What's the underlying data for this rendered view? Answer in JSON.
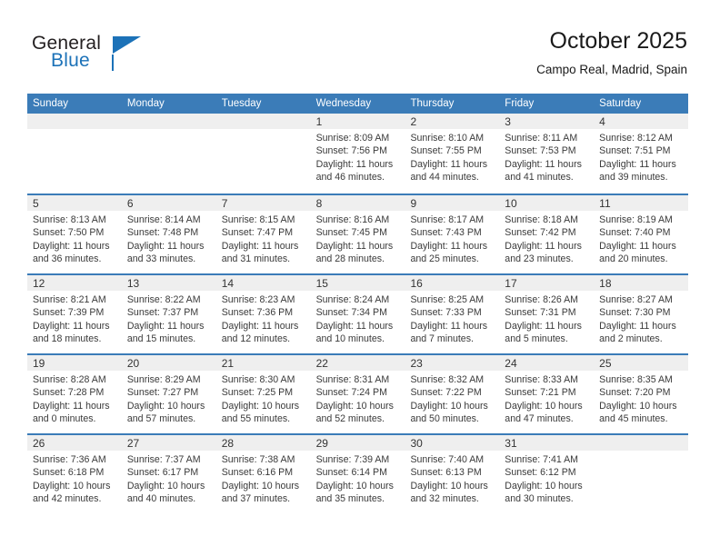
{
  "brand": {
    "name_top": "General",
    "name_bottom": "Blue",
    "accent_color": "#1c72b8",
    "logo_icon": "triangle-flag-icon"
  },
  "header": {
    "title": "October 2025",
    "subtitle": "Campo Real, Madrid, Spain"
  },
  "theme": {
    "header_blue": "#3b7cb8",
    "date_band_gray": "#efefef",
    "text_color": "#3a3a3a"
  },
  "calendar": {
    "weekday_headers": [
      "Sunday",
      "Monday",
      "Tuesday",
      "Wednesday",
      "Thursday",
      "Friday",
      "Saturday"
    ],
    "weeks": [
      [
        {
          "day": "",
          "sunrise": "",
          "sunset": "",
          "daylight1": "",
          "daylight2": ""
        },
        {
          "day": "",
          "sunrise": "",
          "sunset": "",
          "daylight1": "",
          "daylight2": ""
        },
        {
          "day": "",
          "sunrise": "",
          "sunset": "",
          "daylight1": "",
          "daylight2": ""
        },
        {
          "day": "1",
          "sunrise": "Sunrise: 8:09 AM",
          "sunset": "Sunset: 7:56 PM",
          "daylight1": "Daylight: 11 hours",
          "daylight2": "and 46 minutes."
        },
        {
          "day": "2",
          "sunrise": "Sunrise: 8:10 AM",
          "sunset": "Sunset: 7:55 PM",
          "daylight1": "Daylight: 11 hours",
          "daylight2": "and 44 minutes."
        },
        {
          "day": "3",
          "sunrise": "Sunrise: 8:11 AM",
          "sunset": "Sunset: 7:53 PM",
          "daylight1": "Daylight: 11 hours",
          "daylight2": "and 41 minutes."
        },
        {
          "day": "4",
          "sunrise": "Sunrise: 8:12 AM",
          "sunset": "Sunset: 7:51 PM",
          "daylight1": "Daylight: 11 hours",
          "daylight2": "and 39 minutes."
        }
      ],
      [
        {
          "day": "5",
          "sunrise": "Sunrise: 8:13 AM",
          "sunset": "Sunset: 7:50 PM",
          "daylight1": "Daylight: 11 hours",
          "daylight2": "and 36 minutes."
        },
        {
          "day": "6",
          "sunrise": "Sunrise: 8:14 AM",
          "sunset": "Sunset: 7:48 PM",
          "daylight1": "Daylight: 11 hours",
          "daylight2": "and 33 minutes."
        },
        {
          "day": "7",
          "sunrise": "Sunrise: 8:15 AM",
          "sunset": "Sunset: 7:47 PM",
          "daylight1": "Daylight: 11 hours",
          "daylight2": "and 31 minutes."
        },
        {
          "day": "8",
          "sunrise": "Sunrise: 8:16 AM",
          "sunset": "Sunset: 7:45 PM",
          "daylight1": "Daylight: 11 hours",
          "daylight2": "and 28 minutes."
        },
        {
          "day": "9",
          "sunrise": "Sunrise: 8:17 AM",
          "sunset": "Sunset: 7:43 PM",
          "daylight1": "Daylight: 11 hours",
          "daylight2": "and 25 minutes."
        },
        {
          "day": "10",
          "sunrise": "Sunrise: 8:18 AM",
          "sunset": "Sunset: 7:42 PM",
          "daylight1": "Daylight: 11 hours",
          "daylight2": "and 23 minutes."
        },
        {
          "day": "11",
          "sunrise": "Sunrise: 8:19 AM",
          "sunset": "Sunset: 7:40 PM",
          "daylight1": "Daylight: 11 hours",
          "daylight2": "and 20 minutes."
        }
      ],
      [
        {
          "day": "12",
          "sunrise": "Sunrise: 8:21 AM",
          "sunset": "Sunset: 7:39 PM",
          "daylight1": "Daylight: 11 hours",
          "daylight2": "and 18 minutes."
        },
        {
          "day": "13",
          "sunrise": "Sunrise: 8:22 AM",
          "sunset": "Sunset: 7:37 PM",
          "daylight1": "Daylight: 11 hours",
          "daylight2": "and 15 minutes."
        },
        {
          "day": "14",
          "sunrise": "Sunrise: 8:23 AM",
          "sunset": "Sunset: 7:36 PM",
          "daylight1": "Daylight: 11 hours",
          "daylight2": "and 12 minutes."
        },
        {
          "day": "15",
          "sunrise": "Sunrise: 8:24 AM",
          "sunset": "Sunset: 7:34 PM",
          "daylight1": "Daylight: 11 hours",
          "daylight2": "and 10 minutes."
        },
        {
          "day": "16",
          "sunrise": "Sunrise: 8:25 AM",
          "sunset": "Sunset: 7:33 PM",
          "daylight1": "Daylight: 11 hours",
          "daylight2": "and 7 minutes."
        },
        {
          "day": "17",
          "sunrise": "Sunrise: 8:26 AM",
          "sunset": "Sunset: 7:31 PM",
          "daylight1": "Daylight: 11 hours",
          "daylight2": "and 5 minutes."
        },
        {
          "day": "18",
          "sunrise": "Sunrise: 8:27 AM",
          "sunset": "Sunset: 7:30 PM",
          "daylight1": "Daylight: 11 hours",
          "daylight2": "and 2 minutes."
        }
      ],
      [
        {
          "day": "19",
          "sunrise": "Sunrise: 8:28 AM",
          "sunset": "Sunset: 7:28 PM",
          "daylight1": "Daylight: 11 hours",
          "daylight2": "and 0 minutes."
        },
        {
          "day": "20",
          "sunrise": "Sunrise: 8:29 AM",
          "sunset": "Sunset: 7:27 PM",
          "daylight1": "Daylight: 10 hours",
          "daylight2": "and 57 minutes."
        },
        {
          "day": "21",
          "sunrise": "Sunrise: 8:30 AM",
          "sunset": "Sunset: 7:25 PM",
          "daylight1": "Daylight: 10 hours",
          "daylight2": "and 55 minutes."
        },
        {
          "day": "22",
          "sunrise": "Sunrise: 8:31 AM",
          "sunset": "Sunset: 7:24 PM",
          "daylight1": "Daylight: 10 hours",
          "daylight2": "and 52 minutes."
        },
        {
          "day": "23",
          "sunrise": "Sunrise: 8:32 AM",
          "sunset": "Sunset: 7:22 PM",
          "daylight1": "Daylight: 10 hours",
          "daylight2": "and 50 minutes."
        },
        {
          "day": "24",
          "sunrise": "Sunrise: 8:33 AM",
          "sunset": "Sunset: 7:21 PM",
          "daylight1": "Daylight: 10 hours",
          "daylight2": "and 47 minutes."
        },
        {
          "day": "25",
          "sunrise": "Sunrise: 8:35 AM",
          "sunset": "Sunset: 7:20 PM",
          "daylight1": "Daylight: 10 hours",
          "daylight2": "and 45 minutes."
        }
      ],
      [
        {
          "day": "26",
          "sunrise": "Sunrise: 7:36 AM",
          "sunset": "Sunset: 6:18 PM",
          "daylight1": "Daylight: 10 hours",
          "daylight2": "and 42 minutes."
        },
        {
          "day": "27",
          "sunrise": "Sunrise: 7:37 AM",
          "sunset": "Sunset: 6:17 PM",
          "daylight1": "Daylight: 10 hours",
          "daylight2": "and 40 minutes."
        },
        {
          "day": "28",
          "sunrise": "Sunrise: 7:38 AM",
          "sunset": "Sunset: 6:16 PM",
          "daylight1": "Daylight: 10 hours",
          "daylight2": "and 37 minutes."
        },
        {
          "day": "29",
          "sunrise": "Sunrise: 7:39 AM",
          "sunset": "Sunset: 6:14 PM",
          "daylight1": "Daylight: 10 hours",
          "daylight2": "and 35 minutes."
        },
        {
          "day": "30",
          "sunrise": "Sunrise: 7:40 AM",
          "sunset": "Sunset: 6:13 PM",
          "daylight1": "Daylight: 10 hours",
          "daylight2": "and 32 minutes."
        },
        {
          "day": "31",
          "sunrise": "Sunrise: 7:41 AM",
          "sunset": "Sunset: 6:12 PM",
          "daylight1": "Daylight: 10 hours",
          "daylight2": "and 30 minutes."
        },
        {
          "day": "",
          "sunrise": "",
          "sunset": "",
          "daylight1": "",
          "daylight2": ""
        }
      ]
    ]
  }
}
